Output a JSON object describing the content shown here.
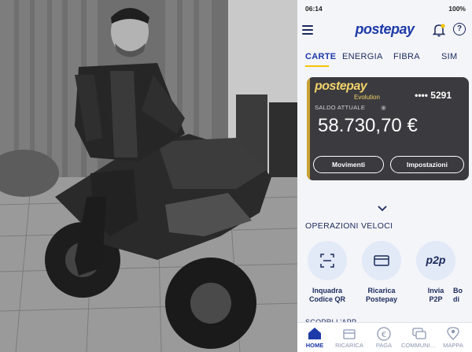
{
  "status": {
    "time": "06:14",
    "battery": "100%"
  },
  "app": {
    "logo": "postepay"
  },
  "tabs": [
    "CARTE",
    "ENERGIA",
    "FIBRA",
    "SIM"
  ],
  "card": {
    "brand": "postepay",
    "subbrand": "Evolution",
    "number": "•••• 5291",
    "balance_label": "SALDO ATTUALE",
    "balance": "58.730,70 €",
    "buttons": {
      "movimenti": "Movimenti",
      "impostazioni": "Impostazioni"
    }
  },
  "quick_ops": {
    "title": "OPERAZIONI VELOCI",
    "items": [
      {
        "label1": "Inquadra",
        "label2": "Codice QR",
        "icon": "qr-scan-icon"
      },
      {
        "label1": "Ricarica",
        "label2": "Postepay",
        "icon": "card-icon"
      },
      {
        "label1": "Invia",
        "label2": "P2P",
        "icon": "p2p-icon",
        "glyph": "p2p"
      },
      {
        "label1": "Bo",
        "label2": "di",
        "icon": "partial-icon"
      }
    ]
  },
  "scopri": "SCOPRI L'APP",
  "bottom_nav": [
    "HOME",
    "RICARICA",
    "PAGA",
    "COMMUNI…",
    "MAPPA"
  ],
  "colors": {
    "brand_blue": "#1d3aa8",
    "card_dark": "#3a3a3f",
    "gold": "#c9a233"
  }
}
